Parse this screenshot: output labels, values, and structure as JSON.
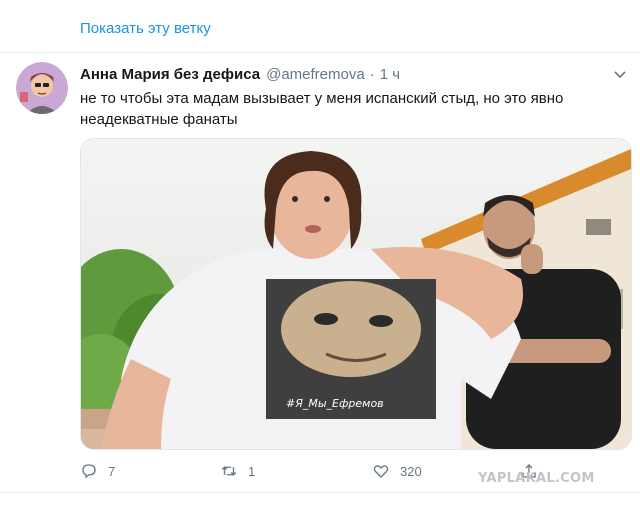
{
  "thread": {
    "show_thread_label": "Показать эту ветку"
  },
  "tweet": {
    "display_name": "Анна Мария без дефиса",
    "handle": "@amefremova",
    "separator": "·",
    "time": "1 ч",
    "text": "не то чтобы эта мадам вызывает у меня испанский стыд, но это явно неадекватные фанаты",
    "shirt_text": "#Я_Мы_Ефремов",
    "icons": {
      "more": "chevron-down-icon",
      "reply": "reply-icon",
      "retweet": "retweet-icon",
      "like": "heart-icon",
      "share": "share-icon"
    }
  },
  "actions": {
    "reply_count": "7",
    "retweet_count": "1",
    "like_count": "320"
  },
  "watermark": "YAPLAKAL.COM",
  "colors": {
    "link": "#1b95e0",
    "muted": "#657786",
    "border": "#e6ecf0"
  }
}
